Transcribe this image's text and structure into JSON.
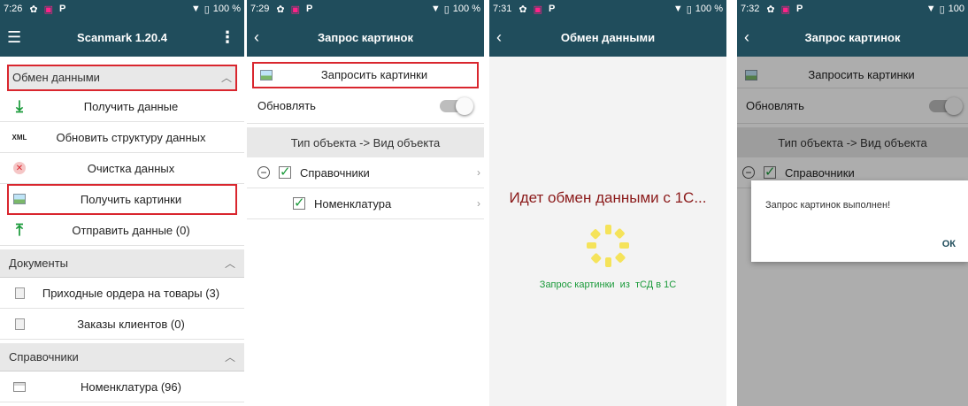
{
  "colors": {
    "appbar": "#204d5c",
    "highlight": "#d9262e",
    "progress_text": "#1a9a3a",
    "exchange_text": "#8b1a1a",
    "spinner": "#f5e35a"
  },
  "screen1": {
    "status": {
      "time": "7:26",
      "battery": "100 %"
    },
    "title": "Scanmark 1.20.4",
    "section_exchange": "Обмен данными",
    "items": [
      "Получить данные",
      "Обновить структуру данных",
      "Очистка данных",
      "Получить картинки",
      "Отправить данные (0)"
    ],
    "section_docs": "Документы",
    "docs": [
      "Приходные ордера на товары (3)",
      "Заказы клиентов (0)"
    ],
    "section_refs": "Справочники",
    "refs": [
      "Номенклатура (96)"
    ]
  },
  "screen2": {
    "status": {
      "time": "7:29",
      "battery": "100 %"
    },
    "title": "Запрос картинок",
    "request_button": "Запросить картинки",
    "update_label": "Обновлять",
    "type_header": "Тип объекта -> Вид объекта",
    "group_label": "Справочники",
    "child_label": "Номенклатура"
  },
  "screen3": {
    "status": {
      "time": "7:31",
      "battery": "100 %"
    },
    "title": "Обмен данными",
    "exchange_text": "Идет обмен данными с 1С...",
    "progress_text": "Запрос картинки  из  тСД в 1С"
  },
  "screen4": {
    "status": {
      "time": "7:32",
      "battery": "100"
    },
    "title": "Запрос картинок",
    "request_button": "Запросить картинки",
    "update_label": "Обновлять",
    "type_header": "Тип объекта -> Вид объекта",
    "group_label": "Справочники",
    "dialog_message": "Запрос картинок выполнен!",
    "dialog_ok": "ОК"
  }
}
